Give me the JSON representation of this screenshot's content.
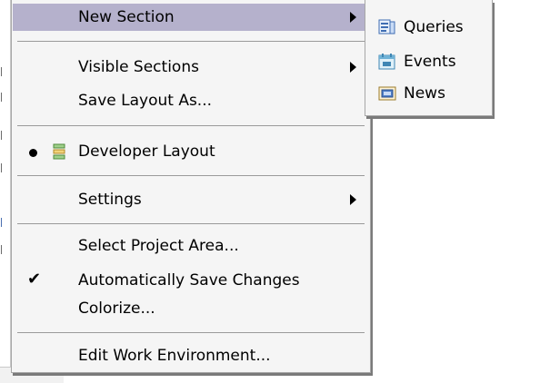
{
  "menu": {
    "items": {
      "new_section": {
        "label": "New Section",
        "has_submenu": true
      },
      "visible_sections": {
        "label": "Visible Sections",
        "has_submenu": true
      },
      "save_layout_as": {
        "label": "Save Layout As..."
      },
      "developer_layout": {
        "label": "Developer Layout",
        "selected": true,
        "icon": "layout-icon"
      },
      "settings": {
        "label": "Settings",
        "has_submenu": true
      },
      "select_project_area": {
        "label": "Select Project Area..."
      },
      "automatically_save_changes": {
        "label": "Automatically Save Changes",
        "checked": true
      },
      "colorize": {
        "label": "Colorize..."
      },
      "edit_work_environment": {
        "label": "Edit Work Environment..."
      }
    }
  },
  "submenu": {
    "items": [
      {
        "label": "Queries",
        "icon": "queries-icon"
      },
      {
        "label": "Events",
        "icon": "events-icon"
      },
      {
        "label": "News",
        "icon": "news-icon"
      }
    ]
  },
  "colors": {
    "menu_bg": "#f5f5f5",
    "highlight": "#b5b1cc",
    "separator": "#9a9a9a",
    "border": "#a7a7a7"
  }
}
